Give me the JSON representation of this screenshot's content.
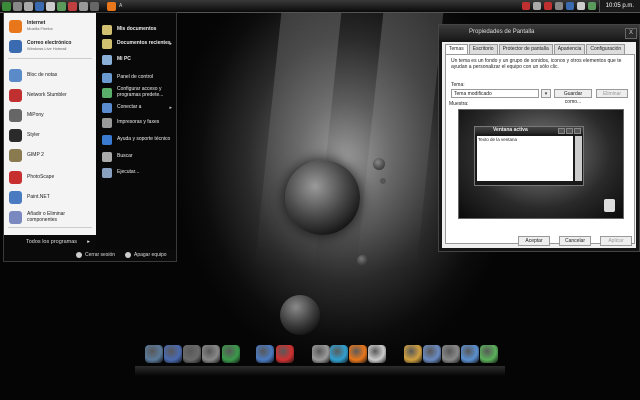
{
  "topbar": {
    "clock": "10:05 p.m.",
    "mid_label": "A"
  },
  "start_menu": {
    "left_items": [
      {
        "label": "Internet",
        "sub": "Mozilla Firefox",
        "icon": "firefox-icon",
        "color": "#e8761b"
      },
      {
        "label": "Correo electrónico",
        "sub": "Windows Live Hotmail",
        "icon": "mail-icon",
        "color": "#3a6ab0"
      },
      {
        "label": "Bloc de notas",
        "sub": "",
        "icon": "notepad-icon",
        "color": "#5a8ac8"
      },
      {
        "label": "Network Stumbler",
        "sub": "",
        "icon": "network-stumbler-icon",
        "color": "#c03030"
      },
      {
        "label": "MiPony",
        "sub": "",
        "icon": "mipony-icon",
        "color": "#666666"
      },
      {
        "label": "Styler",
        "sub": "",
        "icon": "styler-icon",
        "color": "#2a2a2a"
      },
      {
        "label": "GIMP 2",
        "sub": "",
        "icon": "gimp-icon",
        "color": "#8a7a50"
      },
      {
        "label": "PhotoScape",
        "sub": "",
        "icon": "photoscape-icon",
        "color": "#c83030"
      },
      {
        "label": "Paint.NET",
        "sub": "",
        "icon": "paintnet-icon",
        "color": "#4a7ac0"
      },
      {
        "label": "Añadir o Eliminar componentes",
        "sub": "",
        "icon": "add-remove-icon",
        "color": "#7a8ac0"
      }
    ],
    "all_programs": "Todos los programas",
    "right_items": [
      {
        "label": "Mis documentos",
        "bold": true,
        "arrow": false,
        "icon": "documents-icon",
        "color": "#d0c070"
      },
      {
        "label": "Documentos recientes",
        "bold": true,
        "arrow": true,
        "icon": "recent-docs-icon",
        "color": "#d0c070"
      },
      {
        "label": "Mi PC",
        "bold": true,
        "arrow": false,
        "icon": "my-computer-icon",
        "color": "#8ab0d8"
      },
      {
        "label": "Panel de control",
        "bold": false,
        "arrow": false,
        "icon": "control-panel-icon",
        "color": "#6a9ad0"
      },
      {
        "label": "Configurar acceso y programas predete...",
        "bold": false,
        "arrow": false,
        "icon": "default-programs-icon",
        "color": "#5ab06a"
      },
      {
        "label": "Conectar a",
        "bold": false,
        "arrow": true,
        "icon": "connect-icon",
        "color": "#5a8ad0"
      },
      {
        "label": "Impresoras y faxes",
        "bold": false,
        "arrow": false,
        "icon": "printer-icon",
        "color": "#9a9a9a"
      },
      {
        "label": "Ayuda y soporte técnico",
        "bold": false,
        "arrow": false,
        "icon": "help-icon",
        "color": "#3a7ad0"
      },
      {
        "label": "Buscar",
        "bold": false,
        "arrow": false,
        "icon": "search-icon",
        "color": "#aaaaaa"
      },
      {
        "label": "Ejecutar...",
        "bold": false,
        "arrow": false,
        "icon": "run-icon",
        "color": "#8aa0c0"
      }
    ],
    "logoff": "Cerrar sesión",
    "shutdown": "Apagar equipo"
  },
  "dialog": {
    "title": "Propiedades de Pantalla",
    "close": "X",
    "tabs": [
      "Temas",
      "Escritorio",
      "Protector de pantalla",
      "Apariencia",
      "Configuración"
    ],
    "intro": "Un tema es un fondo y un grupo de sonidos, iconos y otros elementos que te ayudan a personalizar el equipo con un sólo clic.",
    "theme_label": "Tema:",
    "theme_value": "Tema modificado",
    "save_as": "Guardar como...",
    "delete": "Eliminar",
    "sample_label": "Muestra:",
    "preview_title": "Ventana activa",
    "preview_text": "Texto de la ventana",
    "accept": "Aceptar",
    "cancel": "Cancelar",
    "apply": "Aplicar"
  },
  "dock": {
    "icons": [
      {
        "name": "dock-network-icon",
        "color": "#5a7a9a"
      },
      {
        "name": "dock-folder-icon",
        "color": "#4a6ab0"
      },
      {
        "name": "dock-monitor-icon",
        "color": "#6a6a6a"
      },
      {
        "name": "dock-film-icon",
        "color": "#888888"
      },
      {
        "name": "dock-globe-icon",
        "color": "#3a9a4a"
      },
      {
        "name": "dock-desktop-icon",
        "color": "#4a7ac0"
      },
      {
        "name": "dock-screen-icon",
        "color": "#d03030"
      },
      {
        "name": "dock-music-icon",
        "color": "#9a9a9a"
      },
      {
        "name": "dock-messenger-icon",
        "color": "#30a0d0"
      },
      {
        "name": "dock-firefox-icon",
        "color": "#e8761b"
      },
      {
        "name": "dock-paw-icon",
        "color": "#cccccc"
      },
      {
        "name": "dock-settings-icon",
        "color": "#d0a040"
      },
      {
        "name": "dock-calendar-icon",
        "color": "#6a8ac0"
      },
      {
        "name": "dock-clock-icon",
        "color": "#888888"
      },
      {
        "name": "dock-media-icon",
        "color": "#5a90d0"
      },
      {
        "name": "dock-users-icon",
        "color": "#5ab05a"
      }
    ]
  }
}
